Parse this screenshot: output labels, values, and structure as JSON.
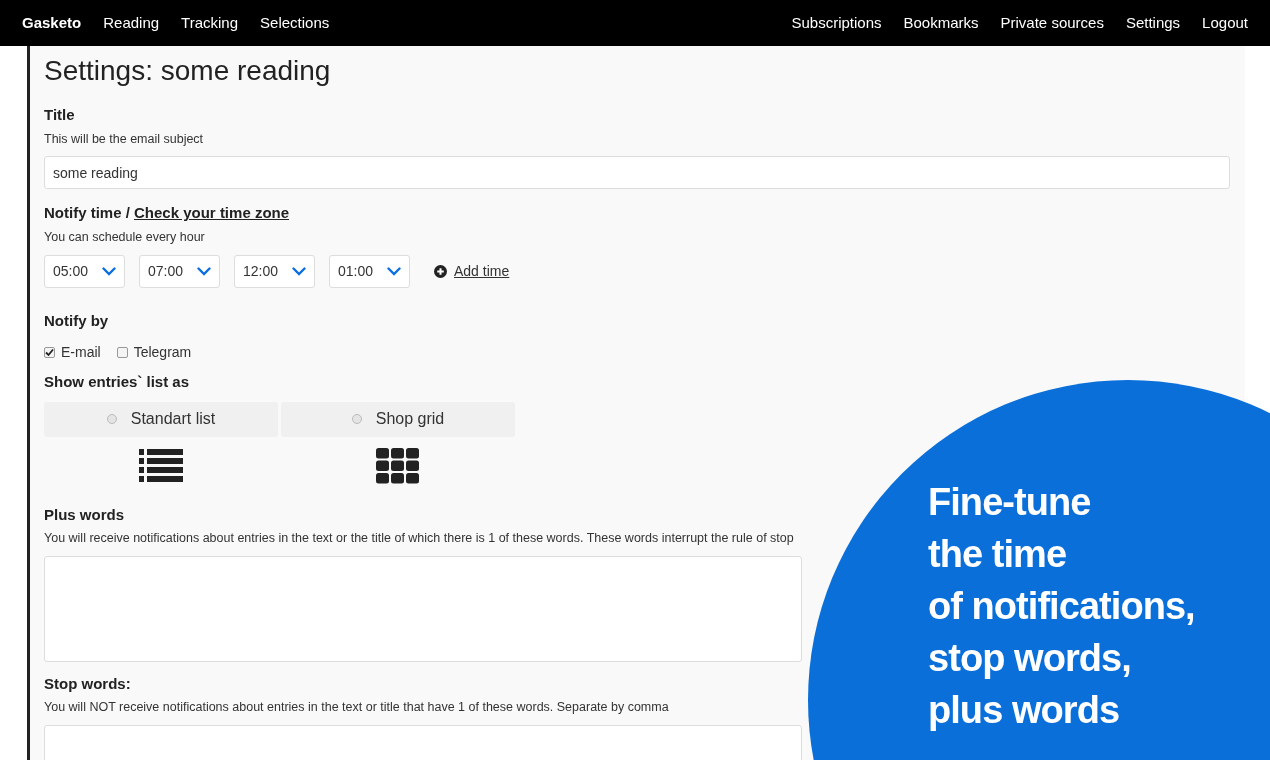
{
  "navbar": {
    "brand": "Gasketo",
    "left_items": [
      "Reading",
      "Tracking",
      "Selections"
    ],
    "right_items": [
      "Subscriptions",
      "Bookmarks",
      "Private sources",
      "Settings",
      "Logout"
    ]
  },
  "page_title": "Settings: some reading",
  "title_field": {
    "label": "Title",
    "hint": "This will be the email subject",
    "value": "some reading"
  },
  "notify_time": {
    "label": "Notify time / ",
    "link": "Check your time zone",
    "hint": "You can schedule every hour",
    "times": [
      "05:00",
      "07:00",
      "12:00",
      "01:00"
    ],
    "add_label": "Add time"
  },
  "notify_by": {
    "label": "Notify by",
    "options": [
      {
        "label": "E-mail",
        "checked": true
      },
      {
        "label": "Telegram",
        "checked": false
      }
    ]
  },
  "list_view": {
    "label": "Show entries` list as",
    "options": [
      {
        "label": "Standart list",
        "kind": "list",
        "selected": false
      },
      {
        "label": "Shop grid",
        "kind": "grid",
        "selected": false
      }
    ]
  },
  "plus_words": {
    "label": "Plus words",
    "hint": "You will receive notifications about entries in the text or the title of which there is 1 of these words. These words interrupt the rule of stop"
  },
  "stop_words": {
    "label": "Stop words:",
    "hint": "You will NOT receive notifications about entries in the text or title that have 1 of these words. Separate by comma"
  },
  "promo": {
    "lines": [
      "Fine-tune",
      "the time",
      "of notifications,",
      "stop words,",
      "plus words"
    ]
  }
}
